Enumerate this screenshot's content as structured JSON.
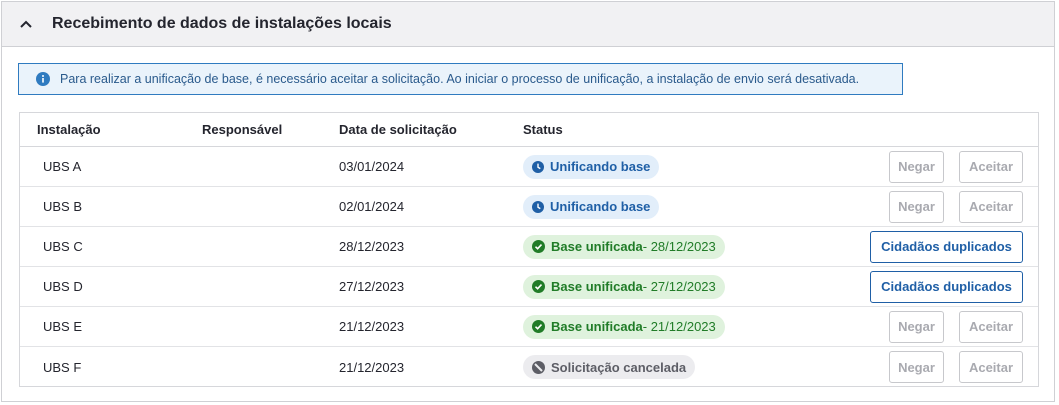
{
  "panel": {
    "title": "Recebimento de dados de instalações locais"
  },
  "alert": {
    "message": "Para realizar a unificação de base, é necessário aceitar a solicitação. Ao iniciar o processo de unificação, a instalação de envio será desativada."
  },
  "table": {
    "headers": {
      "installation": "Instalação",
      "responsible": "Responsável",
      "request_date": "Data de solicitação",
      "status": "Status"
    },
    "rows": [
      {
        "installation": "UBS A",
        "responsible": "",
        "date": "03/01/2024",
        "status": "Unificando base",
        "status_date": "",
        "status_type": "processing",
        "actions": {
          "deny": "Negar",
          "accept": "Aceitar"
        }
      },
      {
        "installation": "UBS B",
        "responsible": "",
        "date": "02/01/2024",
        "status": "Unificando base",
        "status_date": "",
        "status_type": "processing",
        "actions": {
          "deny": "Negar",
          "accept": "Aceitar"
        }
      },
      {
        "installation": "UBS C",
        "responsible": "",
        "date": "28/12/2023",
        "status": "Base unificada",
        "status_date": " - 28/12/2023",
        "status_type": "done",
        "actions": {
          "duplicates": "Cidadãos duplicados"
        }
      },
      {
        "installation": "UBS D",
        "responsible": "",
        "date": "27/12/2023",
        "status": "Base unificada",
        "status_date": " - 27/12/2023",
        "status_type": "done",
        "actions": {
          "duplicates": "Cidadãos duplicados"
        }
      },
      {
        "installation": "UBS E",
        "responsible": "",
        "date": "21/12/2023",
        "status": "Base unificada",
        "status_date": " - 21/12/2023",
        "status_type": "done",
        "actions": {
          "deny": "Negar",
          "accept": "Aceitar"
        }
      },
      {
        "installation": "UBS F",
        "responsible": "",
        "date": "21/12/2023",
        "status": "Solicitação cancelada",
        "status_date": "",
        "status_type": "cancel",
        "actions": {
          "deny": "Negar",
          "accept": "Aceitar"
        }
      }
    ]
  },
  "colors": {
    "processing": "#1f5fa6",
    "done": "#217c28",
    "cancel": "#5d5e66",
    "info": "#2f7bc0"
  },
  "icons": {
    "collapse": "chevron-up-icon",
    "info": "info-icon",
    "processing": "clock-icon",
    "done": "check-circle-icon",
    "cancel": "ban-icon"
  }
}
